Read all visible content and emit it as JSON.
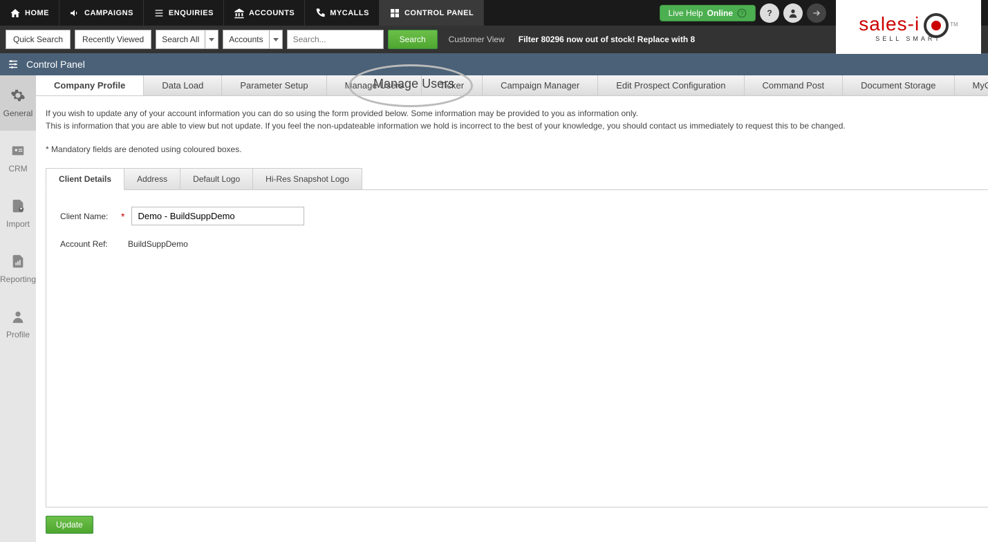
{
  "topnav": {
    "items": [
      {
        "label": "HOME"
      },
      {
        "label": "CAMPAIGNS"
      },
      {
        "label": "ENQUIRIES"
      },
      {
        "label": "ACCOUNTS"
      },
      {
        "label": "MYCALLS"
      },
      {
        "label": "CONTROL PANEL"
      }
    ],
    "livehelp_prefix": "Live Help",
    "livehelp_status": "Online"
  },
  "logo": {
    "brand": "sales-i",
    "tagline": "SELL SMART",
    "tm": "TM"
  },
  "searchrow": {
    "quick_search": "Quick Search",
    "recently_viewed": "Recently Viewed",
    "search_all": "Search All",
    "accounts": "Accounts",
    "search_placeholder": "Search...",
    "search_btn": "Search",
    "customer_view": "Customer View",
    "filter_text": "Filter 80296 now out of stock! Replace with 8"
  },
  "breadcrumb": {
    "title": "Control Panel"
  },
  "sidebar": {
    "items": [
      {
        "label": "General"
      },
      {
        "label": "CRM"
      },
      {
        "label": "Import"
      },
      {
        "label": "Reporting"
      },
      {
        "label": "Profile"
      }
    ]
  },
  "section_tabs": {
    "items": [
      {
        "label": "Company Profile"
      },
      {
        "label": "Data Load"
      },
      {
        "label": "Parameter Setup"
      },
      {
        "label": "Manage Users"
      },
      {
        "label": "Ticker"
      },
      {
        "label": "Campaign Manager"
      },
      {
        "label": "Edit Prospect Configuration"
      },
      {
        "label": "Command Post"
      },
      {
        "label": "Document Storage"
      },
      {
        "label": "MyCalls"
      }
    ]
  },
  "highlight_label": "Manage Users",
  "info_text_1": "If you wish to update any of your account information you can do so using the form provided below. Some information may be provided to you as information only.",
  "info_text_2": "This is information that you are able to view but not update. If you feel the non-updateable information we hold is incorrect to the best of your knowledge, you should contact us immediately to request this to be changed.",
  "mandatory_note": "* Mandatory fields are denoted using coloured boxes.",
  "subtabs": {
    "items": [
      {
        "label": "Client Details"
      },
      {
        "label": "Address"
      },
      {
        "label": "Default Logo"
      },
      {
        "label": "Hi-Res Snapshot Logo"
      }
    ]
  },
  "form": {
    "client_name_label": "Client Name:",
    "client_name_value": "Demo - BuildSuppDemo",
    "account_ref_label": "Account Ref:",
    "account_ref_value": "BuildSuppDemo",
    "required_mark": "*"
  },
  "update_btn": "Update"
}
